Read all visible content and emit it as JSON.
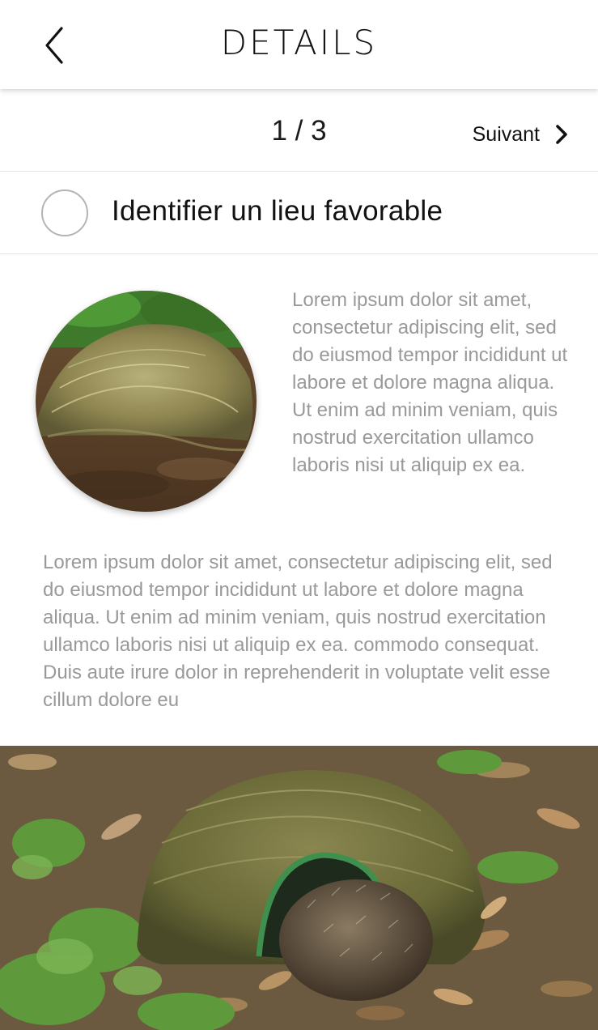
{
  "header": {
    "title": "DETAILS",
    "back_icon": "chevron-left-icon"
  },
  "pager": {
    "count": "1 / 3",
    "next_label": "Suivant",
    "next_icon": "chevron-right-icon"
  },
  "task": {
    "title": "Identifier un lieu favorable",
    "checked": false
  },
  "content": {
    "side_text": "Lorem ipsum dolor sit amet, consectetur adipiscing elit, sed do eiusmod tempor incididunt ut labore et dolore magna aliqua. Ut enim ad minim veniam, quis nostrud exercitation ullamco laboris nisi ut aliquip ex ea.",
    "body_text": "Lorem ipsum dolor sit amet, consectetur adipiscing elit, sed do eiusmod tempor incididunt ut labore et dolore magna aliqua. Ut enim ad minim veniam, quis nostrud exercitation ullamco laboris nisi ut aliquip ex ea. commodo consequat. Duis aute irure dolor in reprehenderit in voluptate velit esse cillum dolore eu"
  },
  "colors": {
    "text_primary": "#111111",
    "text_secondary": "#999999",
    "divider": "#e3e3e3",
    "checkbox_border": "#b4b4b4"
  }
}
